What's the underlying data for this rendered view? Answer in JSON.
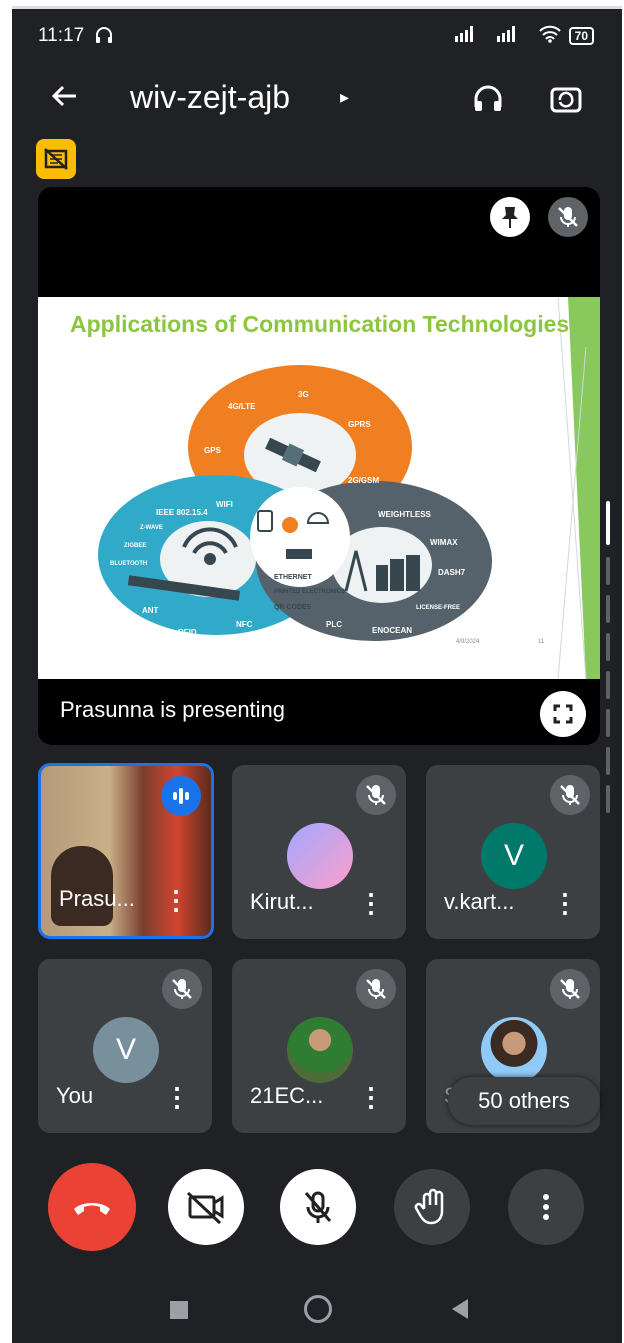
{
  "status": {
    "time": "11:17",
    "battery": "70"
  },
  "meeting": {
    "code": "wiv-zejt-ajb"
  },
  "presentation": {
    "slide_title": "Applications of  Communication Technologies",
    "presenting_text": "Prasunna is presenting",
    "diagram_labels": {
      "top": [
        "4G/LTE",
        "3G",
        "GPRS",
        "GPS",
        "2G/GSM"
      ],
      "left": [
        "IEEE 802.15.4",
        "WIFI",
        "Z-WAVE",
        "ZIGBEE",
        "BLUETOOTH",
        "ANT",
        "RFID",
        "NFC"
      ],
      "center": [
        "ETHERNET",
        "PRINTED ELECTRONICS",
        "QR CODES"
      ],
      "right": [
        "WEIGHTLESS",
        "WIMAX",
        "DASH7",
        "LICENSE-FREE",
        "PLC",
        "ENOCEAN"
      ]
    },
    "slide_date": "4/9/2024",
    "slide_number": "11"
  },
  "participants": [
    {
      "name": "Prasu...",
      "avatar_letter": "",
      "speaking": true
    },
    {
      "name": "Kirut...",
      "avatar_letter": "",
      "speaking": false
    },
    {
      "name": "v.kart...",
      "avatar_letter": "V",
      "speaking": false,
      "avatar_color": "#00796b"
    },
    {
      "name": "You",
      "avatar_letter": "V",
      "speaking": false,
      "avatar_color": "#78909c"
    },
    {
      "name": "21EC...",
      "avatar_letter": "",
      "speaking": false
    },
    {
      "name": "S",
      "avatar_letter": "",
      "speaking": false
    }
  ],
  "others_count": "50 others",
  "controls": {
    "end_call": "end-call-icon",
    "camera": "camera-off-icon",
    "mic": "mic-off-icon",
    "hand": "raise-hand-icon",
    "more": "more-vert-icon"
  },
  "colors": {
    "background": "#202124",
    "tile": "#3c4043",
    "end_call": "#ea4335",
    "speaking": "#1a73e8",
    "slide_title": "#8cc63f"
  }
}
